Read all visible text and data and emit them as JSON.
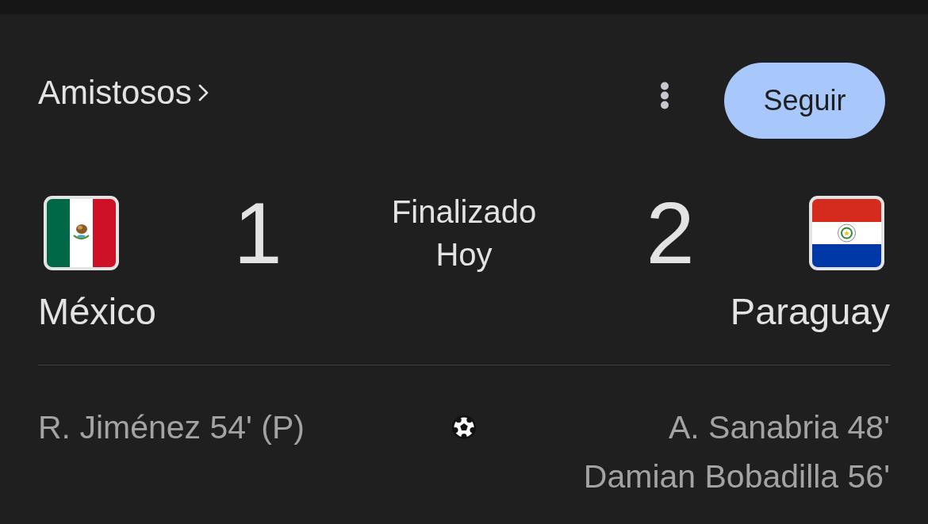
{
  "header": {
    "competition": "Amistosos",
    "follow_button": "Seguir"
  },
  "match": {
    "status": "Finalizado",
    "date": "Hoy",
    "teams": [
      {
        "name": "México",
        "score": "1",
        "kind": "mexico"
      },
      {
        "name": "Paraguay",
        "score": "2",
        "kind": "paraguay"
      }
    ]
  },
  "goals": {
    "home": [
      "R. Jiménez 54' (P)"
    ],
    "away": [
      "A. Sanabria 48'",
      "Damian Bobadilla 56'"
    ]
  }
}
